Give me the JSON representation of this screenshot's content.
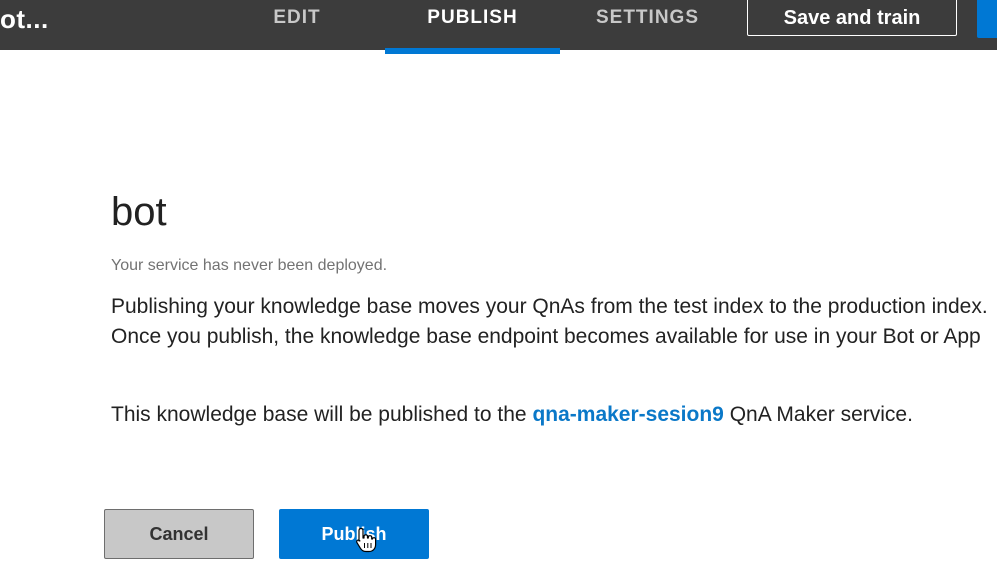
{
  "header": {
    "kb_title": "ot...",
    "tabs": [
      {
        "label": "EDIT",
        "active": false
      },
      {
        "label": "PUBLISH",
        "active": true
      },
      {
        "label": "SETTINGS",
        "active": false
      }
    ],
    "save_train_label": "Save and train"
  },
  "main": {
    "kb_name": "bot",
    "status": "Your service has never been deployed.",
    "description": "Publishing your knowledge base moves your QnAs from the test index to the production index. Once you publish, the knowledge base endpoint becomes available for use in your Bot or App",
    "target_prefix": "This knowledge base will be published to the ",
    "service_name": "qna-maker-sesion9",
    "target_suffix": " QnA Maker service."
  },
  "actions": {
    "cancel_label": "Cancel",
    "publish_label": "Publish"
  },
  "colors": {
    "accent": "#0078d4",
    "topbar": "#3c3c3c",
    "link": "#0a78c8"
  },
  "icons": {
    "cursor": "hand-pointer-icon"
  }
}
